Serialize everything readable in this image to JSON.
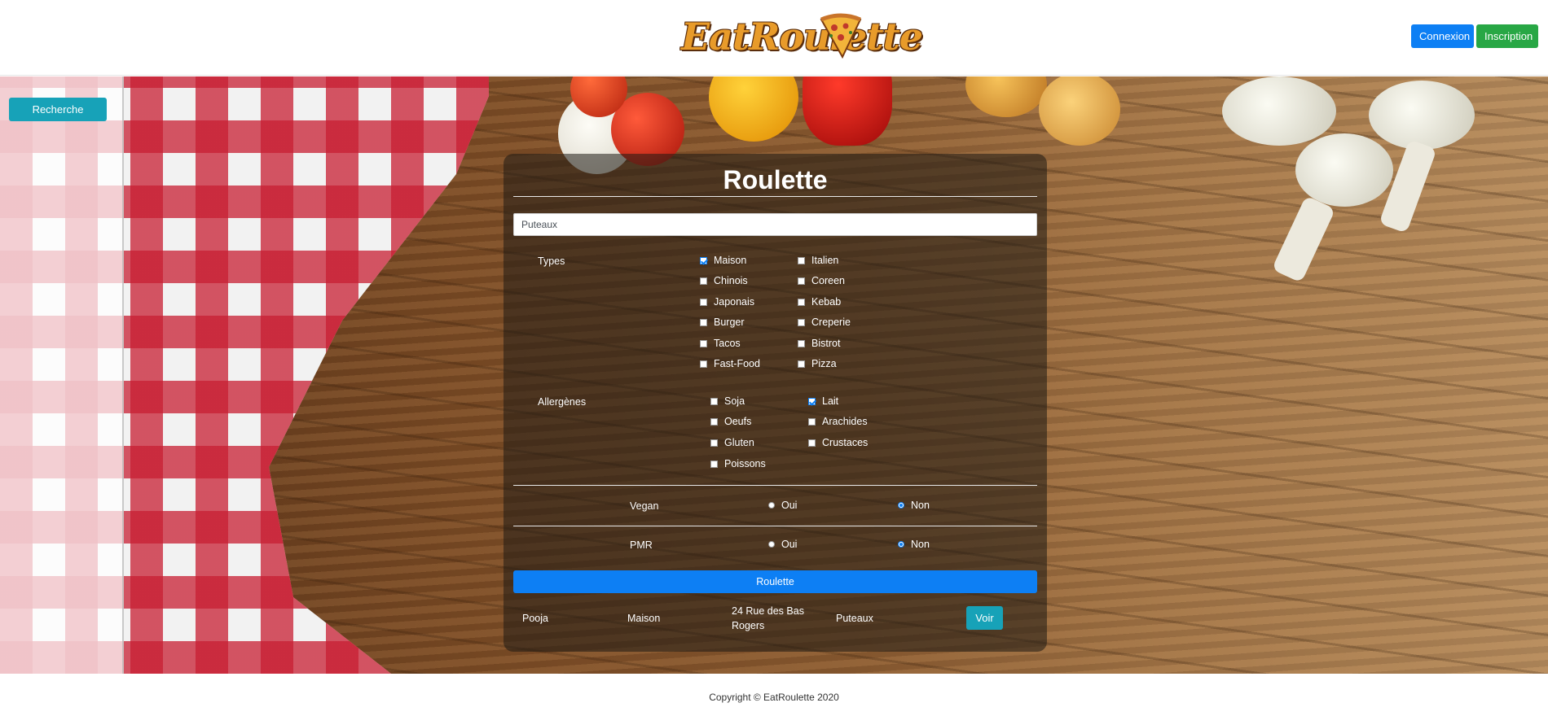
{
  "header": {
    "logo_text": "EatRoulette",
    "login_label": "Connexion",
    "signup_label": "Inscription"
  },
  "sidebar": {
    "search_label": "Recherche"
  },
  "panel": {
    "title": "Roulette",
    "city_value": "Puteaux",
    "types": {
      "label": "Types",
      "items": [
        {
          "label": "Maison",
          "checked": true
        },
        {
          "label": "Italien",
          "checked": false
        },
        {
          "label": "Chinois",
          "checked": false
        },
        {
          "label": "Coreen",
          "checked": false
        },
        {
          "label": "Japonais",
          "checked": false
        },
        {
          "label": "Kebab",
          "checked": false
        },
        {
          "label": "Burger",
          "checked": false
        },
        {
          "label": "Creperie",
          "checked": false
        },
        {
          "label": "Tacos",
          "checked": false
        },
        {
          "label": "Bistrot",
          "checked": false
        },
        {
          "label": "Fast-Food",
          "checked": false
        },
        {
          "label": "Pizza",
          "checked": false
        }
      ]
    },
    "allergens": {
      "label": "Allergènes",
      "items": [
        {
          "label": "Soja",
          "checked": false
        },
        {
          "label": "Lait",
          "checked": true
        },
        {
          "label": "Oeufs",
          "checked": false
        },
        {
          "label": "Arachides",
          "checked": false
        },
        {
          "label": "Gluten",
          "checked": false
        },
        {
          "label": "Crustaces",
          "checked": false
        },
        {
          "label": "Poissons",
          "checked": false
        }
      ]
    },
    "vegan": {
      "label": "Vegan",
      "yes": "Oui",
      "no": "Non",
      "selected": "Non"
    },
    "pmr": {
      "label": "PMR",
      "yes": "Oui",
      "no": "Non",
      "selected": "Non"
    },
    "roulette_label": "Roulette",
    "result": {
      "name": "Pooja",
      "type": "Maison",
      "address_line1": "24 Rue des Bas",
      "address_line2": "Rogers",
      "city": "Puteaux",
      "view_label": "Voir"
    }
  },
  "footer": {
    "copyright": "Copyright © EatRoulette 2020"
  },
  "colors": {
    "primary": "#0d7ff4",
    "success": "#28a745",
    "info": "#17a2b8"
  }
}
